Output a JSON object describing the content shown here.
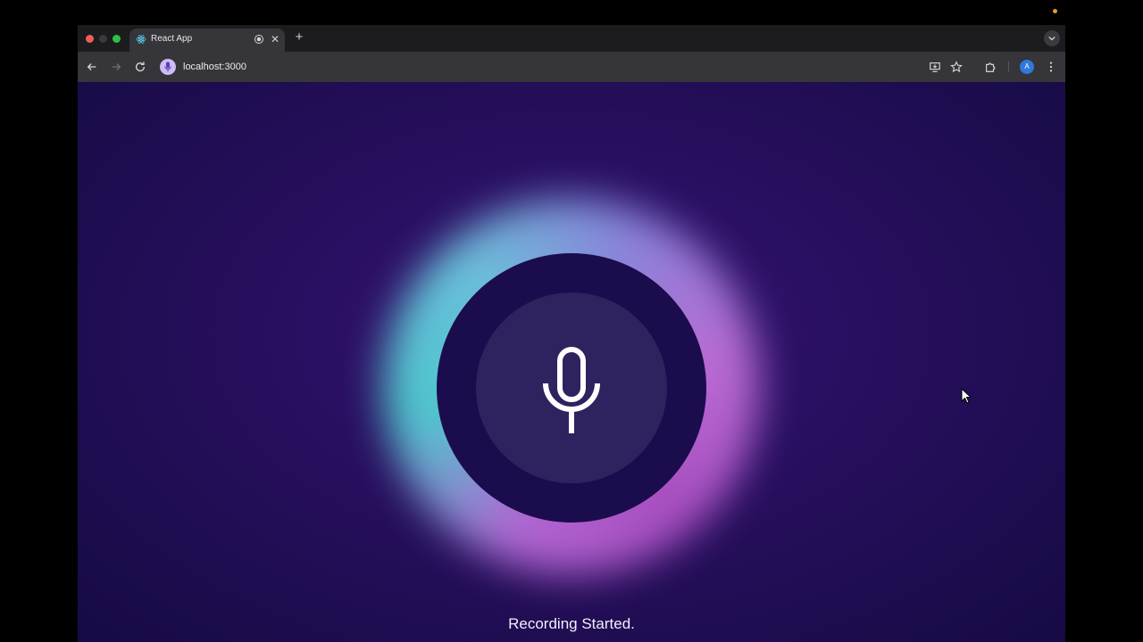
{
  "browser": {
    "tab": {
      "title": "React App",
      "favicon_icon": "react-logo-icon",
      "audio_icon": "audio-recording-icon"
    },
    "new_tab_icon": "plus-icon",
    "tab_search_icon": "chevron-down-icon",
    "toolbar": {
      "back_icon": "arrow-left-icon",
      "forward_icon": "arrow-right-icon",
      "reload_icon": "reload-icon",
      "site_icon": "microphone-icon",
      "url": "localhost:3000",
      "install_icon": "install-app-icon",
      "bookmark_icon": "star-icon",
      "extensions_icon": "puzzle-icon",
      "profile_initial": "A",
      "menu_icon": "kebab-menu-icon"
    }
  },
  "app": {
    "mic_button_icon": "microphone-icon",
    "status": "Recording Started."
  },
  "colors": {
    "background": "#2a1063",
    "mic_outer": "#1b0c4d",
    "mic_inner": "#30225e",
    "glow_teal": "#4fd1d3",
    "glow_pink": "#b052c6"
  }
}
